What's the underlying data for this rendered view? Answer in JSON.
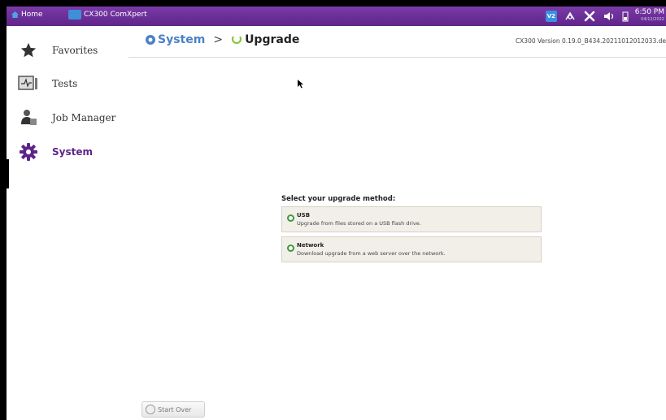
{
  "topbar": {
    "home_label": "Home",
    "app_label": "CX300 ComXpert",
    "vnc_label": "V2",
    "time": "6:50 PM",
    "date": "04/12/2022",
    "icons": [
      "vnc-icon",
      "network-icon",
      "tools-icon",
      "speaker-icon",
      "battery-icon"
    ]
  },
  "sidebar": {
    "items": [
      {
        "label": "Favorites",
        "icon": "star-icon",
        "active": false
      },
      {
        "label": "Tests",
        "icon": "tests-icon",
        "active": false
      },
      {
        "label": "Job Manager",
        "icon": "job-manager-icon",
        "active": false
      },
      {
        "label": "System",
        "icon": "gear-icon",
        "active": true
      }
    ]
  },
  "breadcrumb": {
    "parent": "System",
    "separator": ">",
    "current": "Upgrade"
  },
  "version": "CX300 Version 0.19.0_B434.20211012012033.de",
  "upgrade": {
    "title": "Select your upgrade method:",
    "options": [
      {
        "name": "USB",
        "desc": "Upgrade from files stored on a USB flash drive."
      },
      {
        "name": "Network",
        "desc": "Download upgrade from a web server over the network."
      }
    ]
  },
  "footer": {
    "start_over_label": "Start Over"
  },
  "colors": {
    "topbar": "#5e2589",
    "accent_blue": "#4a80c8",
    "radio_green": "#3a9a3a",
    "option_bg": "#f2efe9"
  }
}
